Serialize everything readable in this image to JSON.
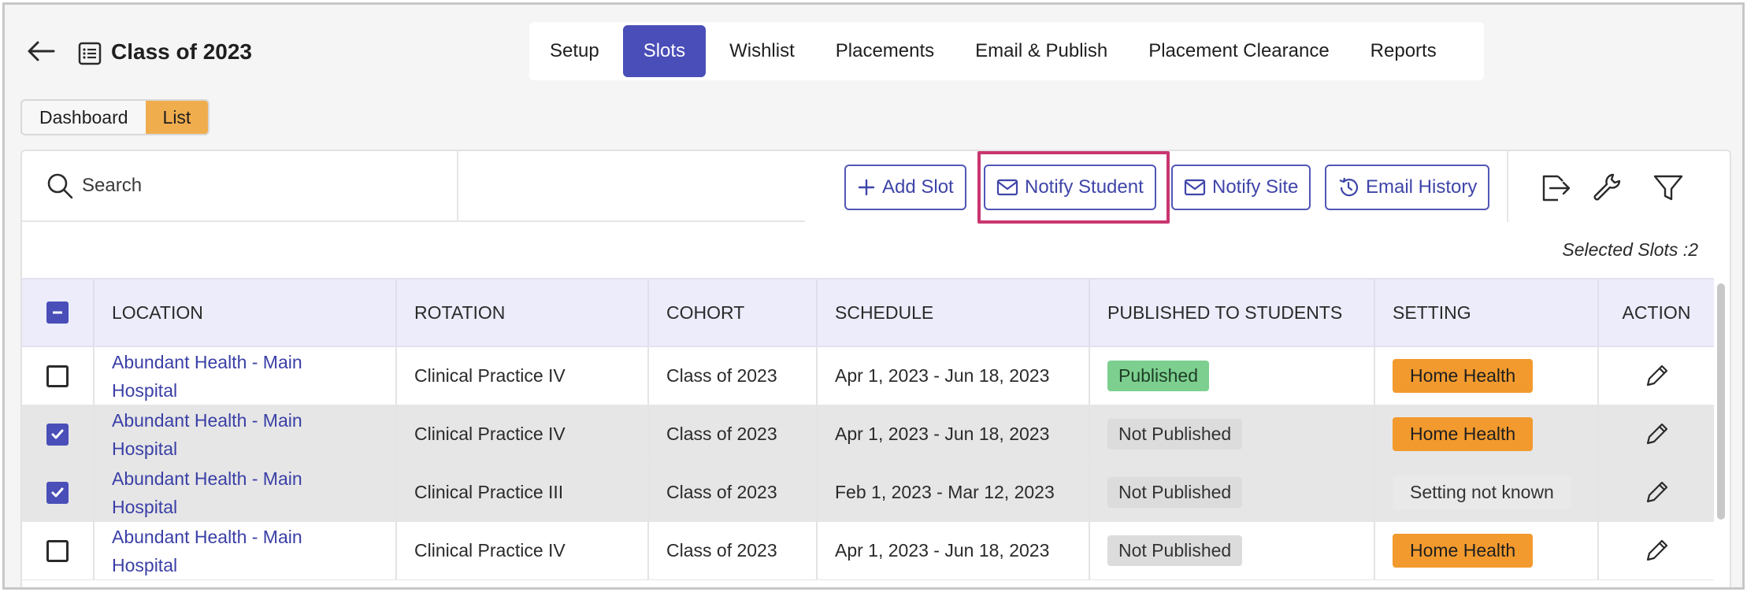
{
  "header": {
    "title": "Class of 2023",
    "tabs": [
      {
        "label": "Setup",
        "active": false
      },
      {
        "label": "Slots",
        "active": true
      },
      {
        "label": "Wishlist",
        "active": false
      },
      {
        "label": "Placements",
        "active": false
      },
      {
        "label": "Email & Publish",
        "active": false
      },
      {
        "label": "Placement Clearance",
        "active": false
      },
      {
        "label": "Reports",
        "active": false
      }
    ],
    "views": [
      {
        "label": "Dashboard",
        "active": false
      },
      {
        "label": "List",
        "active": true
      }
    ]
  },
  "toolbar": {
    "search_placeholder": "Search",
    "add_slot": "Add Slot",
    "notify_student": "Notify Student",
    "notify_site": "Notify Site",
    "email_history": "Email History",
    "icons": [
      "export-icon",
      "wrench-icon",
      "filter-icon"
    ]
  },
  "selected_count": "Selected Slots :2",
  "table": {
    "columns": [
      "LOCATION",
      "ROTATION",
      "COHORT",
      "SCHEDULE",
      "PUBLISHED TO STUDENTS",
      "SETTING",
      "ACTION"
    ],
    "rows": [
      {
        "checked": false,
        "location_line1": "Abundant Health - Main",
        "location_line2": "Hospital",
        "rotation": "Clinical Practice IV",
        "cohort": "Class of 2023",
        "schedule": "Apr 1, 2023 - Jun 18, 2023",
        "published": "Published",
        "setting": "Home Health"
      },
      {
        "checked": true,
        "location_line1": "Abundant Health - Main",
        "location_line2": "Hospital",
        "rotation": "Clinical Practice IV",
        "cohort": "Class of 2023",
        "schedule": "Apr 1, 2023 - Jun 18, 2023",
        "published": "Not Published",
        "setting": "Home Health"
      },
      {
        "checked": true,
        "location_line1": "Abundant Health - Main",
        "location_line2": "Hospital",
        "rotation": "Clinical Practice III",
        "cohort": "Class of 2023",
        "schedule": "Feb 1, 2023 - Mar 12, 2023",
        "published": "Not Published",
        "setting": "Setting not known"
      },
      {
        "checked": false,
        "location_line1": "Abundant Health - Main",
        "location_line2": "Hospital",
        "rotation": "Clinical Practice IV",
        "cohort": "Class of 2023",
        "schedule": "Apr 1, 2023 - Jun 18, 2023",
        "published": "Not Published",
        "setting": "Home Health"
      }
    ]
  },
  "colors": {
    "accent": "#4a4eb8",
    "highlight": "#c9356f",
    "published": "#7dcf8f",
    "home_health": "#f29a2e",
    "list_toggle": "#f0ad4e"
  }
}
